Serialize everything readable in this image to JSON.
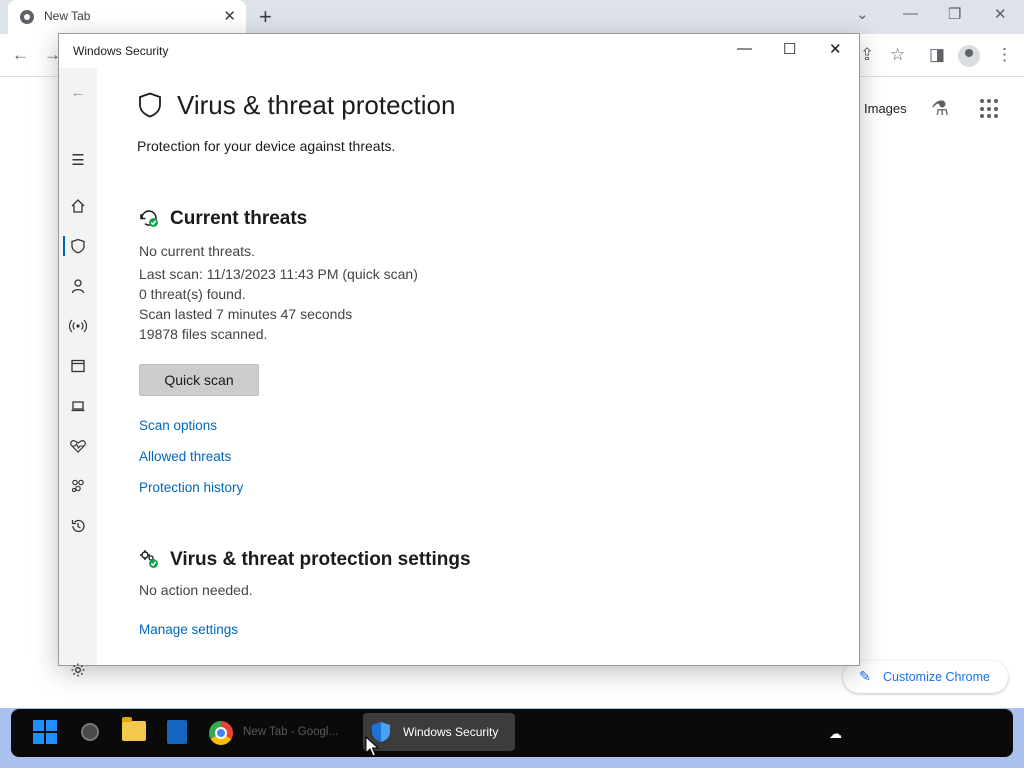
{
  "chrome": {
    "tab_title": "New Tab",
    "tab_close": "✕",
    "new_tab": "+",
    "images_link": "Images",
    "customize_label": "Customize Chrome"
  },
  "window": {
    "title": "Windows Security",
    "minimize": "—",
    "maximize": "☐",
    "close": "✕"
  },
  "page": {
    "title": "Virus & threat protection",
    "subtitle": "Protection for your device against threats."
  },
  "current_threats": {
    "heading": "Current threats",
    "lines": [
      "No current threats.",
      "Last scan: 11/13/2023 11:43 PM (quick scan)",
      "0 threat(s) found.",
      "Scan lasted 7 minutes 47 seconds",
      "19878 files scanned."
    ],
    "quick_scan_label": "Quick scan",
    "links": [
      "Scan options",
      "Allowed threats",
      "Protection history"
    ]
  },
  "settings": {
    "heading": "Virus & threat protection settings",
    "status": "No action needed.",
    "manage_link": "Manage settings"
  },
  "sidebar": {
    "items": [
      {
        "name": "back-icon",
        "glyph": "←"
      },
      {
        "name": "menu-icon",
        "glyph": "☰"
      },
      {
        "name": "home-icon",
        "glyph": "⌂"
      },
      {
        "name": "shield-icon",
        "glyph": "⛉"
      },
      {
        "name": "account-icon",
        "glyph": "♙"
      },
      {
        "name": "network-icon",
        "glyph": "((·))"
      },
      {
        "name": "app-browser-icon",
        "glyph": "▭"
      },
      {
        "name": "device-security-icon",
        "glyph": "▬"
      },
      {
        "name": "health-icon",
        "glyph": "♡"
      },
      {
        "name": "family-icon",
        "glyph": "⚇"
      },
      {
        "name": "history-icon",
        "glyph": "↺"
      },
      {
        "name": "settings-gear-icon",
        "glyph": "⚙"
      }
    ]
  },
  "taskbar": {
    "chrome_label": "New Tab - Googl...",
    "security_label": "Windows Security"
  },
  "colors": {
    "accent": "#0067c0",
    "chrome_link": "#1a73e8",
    "taskbar": "#0a0a0a",
    "desktop": "#aac1ef"
  }
}
